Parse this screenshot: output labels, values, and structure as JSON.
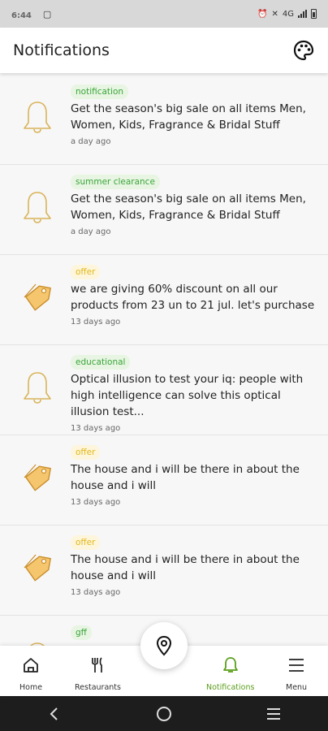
{
  "status_bar": {
    "time": "6:44",
    "network": "4G"
  },
  "app_bar": {
    "title": "Notifications",
    "action_icon": "palette-icon"
  },
  "colors": {
    "accent_green": "#5a9e1a",
    "tag_green": "#3aa53a",
    "tag_yellow": "#e3b81a",
    "icon_gold": "#d9b45a",
    "tag_fill": "#f5c66e"
  },
  "notifications": [
    {
      "icon": "bell-icon",
      "tag": "notification",
      "tag_color": "green",
      "message": "Get the season's big sale on all items Men, Women, Kids, Fragrance & Bridal Stuff",
      "time": "a day ago"
    },
    {
      "icon": "bell-icon",
      "tag": "summer clearance",
      "tag_color": "green",
      "message": "Get the season's big sale on all items Men, Women, Kids, Fragrance & Bridal Stuff",
      "time": "a day ago"
    },
    {
      "icon": "price-tag-icon",
      "tag": "offer",
      "tag_color": "yellow",
      "message": "we are giving 60% discount on all our products from 23 un to 21 jul. let's purchase",
      "time": "13 days ago"
    },
    {
      "icon": "bell-icon",
      "tag": "educational",
      "tag_color": "green",
      "message": "Optical illusion to test your iq: people with high intelligence can solve this optical illusion test...",
      "time": "13 days ago"
    },
    {
      "icon": "price-tag-icon",
      "tag": "offer",
      "tag_color": "yellow",
      "message": "The house and i will be there in about the house and i will",
      "time": "13 days ago"
    },
    {
      "icon": "price-tag-icon",
      "tag": "offer",
      "tag_color": "yellow",
      "message": "The house and i will be there in about the house and i will",
      "time": "13 days ago"
    },
    {
      "icon": "bell-icon",
      "tag": "gff",
      "tag_color": "green",
      "message": "",
      "time": ""
    }
  ],
  "bottom_nav": {
    "items": [
      {
        "label": "Home",
        "icon": "home-icon"
      },
      {
        "label": "Restaurants",
        "icon": "fork-knife-icon"
      },
      {
        "label": "Notifications",
        "icon": "bell-icon",
        "active": true
      },
      {
        "label": "Menu",
        "icon": "hamburger-menu-icon"
      }
    ],
    "fab_icon": "location-pin-icon"
  },
  "system_nav": [
    "back-icon",
    "home-circle-icon",
    "recents-icon"
  ]
}
